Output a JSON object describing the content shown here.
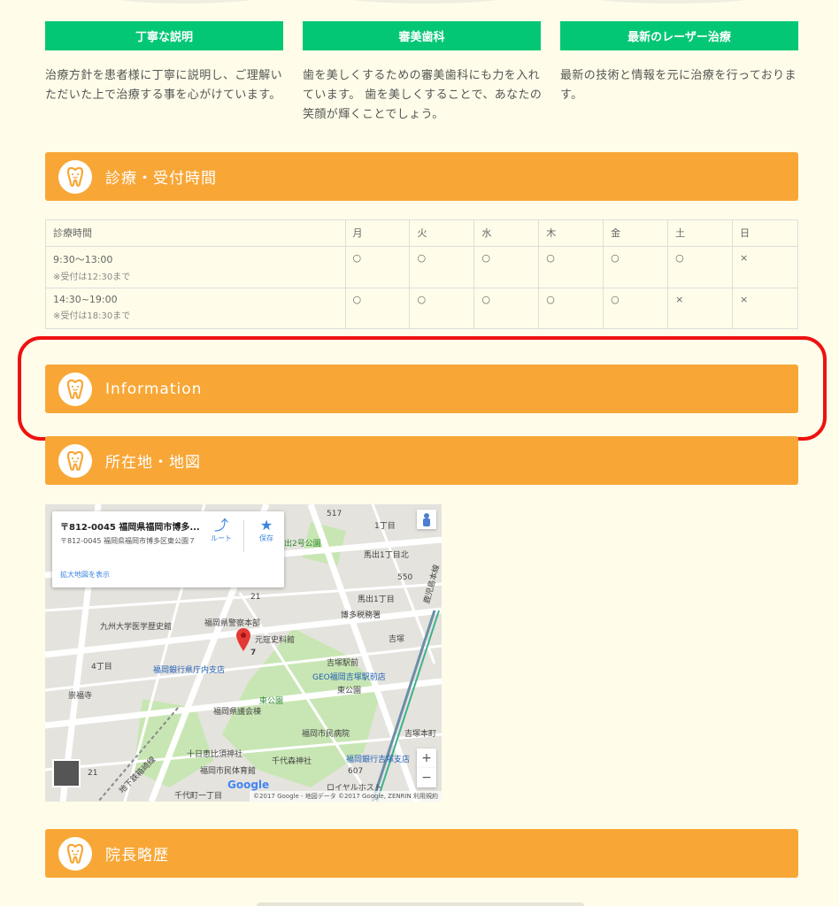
{
  "features": [
    {
      "label": "丁寧な説明",
      "text": "治療方針を患者様に丁寧に説明し、ご理解いただいた上で治療する事を心がけています。"
    },
    {
      "label": "審美歯科",
      "text": "歯を美しくするための審美歯科にも力を入れています。 歯を美しくすることで、あなたの笑顔が輝くことでしょう。"
    },
    {
      "label": "最新のレーザー治療",
      "text": "最新の技術と情報を元に治療を行っております。"
    }
  ],
  "sections": {
    "hours_title": "診療・受付時間",
    "info_title": "Information",
    "location_title": "所在地・地図",
    "profile_title": "院長略歴"
  },
  "hours_table": {
    "header": [
      "診療時間",
      "月",
      "火",
      "水",
      "木",
      "金",
      "土",
      "日"
    ],
    "rows": [
      {
        "time": "9:30～13:00",
        "note": "※受付は12:30まで",
        "marks": [
          "○",
          "○",
          "○",
          "○",
          "○",
          "○",
          "×"
        ]
      },
      {
        "time": "14:30~19:00",
        "note": "※受付は18:30まで",
        "marks": [
          "○",
          "○",
          "○",
          "○",
          "○",
          "×",
          "×"
        ]
      }
    ]
  },
  "map": {
    "card_title": "〒812-0045 福岡県福岡市博多...",
    "card_address": "〒812-0045 福岡県福岡市博多区東公園７",
    "directions_label": "ルート",
    "save_label": "保存",
    "larger_map_link": "拡大地図を表示",
    "labels": {
      "park2": "出2号公園",
      "kyushu_museum": "九州大学医学歴史館",
      "police": "福岡県警察本部",
      "genko": "元寇史料館",
      "tax": "博多税務署",
      "bank_branch": "福岡銀行県庁内支店",
      "geo": "GEO福岡吉塚駅前店",
      "higashi_park": "東公園",
      "assembly": "福岡県議会棟",
      "hospital": "福岡市民病院",
      "yoshizuka_honmachi": "吉塚本町",
      "tokaebisu": "十日恵比須神社",
      "chiyomori": "千代森神社",
      "yoshizuka_bank": "福岡銀行吉塚支店",
      "gym": "福岡市民体育館",
      "yoshizuka": "吉塚",
      "sofukuji": "崇福寺",
      "royal": "ロイヤルホスト",
      "marker_num": "7",
      "chome1": "1丁目",
      "chome4": "4丁目",
      "road517": "517",
      "road21": "21",
      "road550": "550",
      "road607": "607",
      "mazeshi1": "馬出1丁目北",
      "mazeshi2": "馬出1丁目",
      "yoshizuka_st": "吉塚駅前",
      "chiyo": "千代町一丁目",
      "east_line": "鹿児島本線",
      "subway": "地下鉄箱崎線",
      "higashi_koen2": "東公園"
    },
    "google_logo": "Google",
    "attribution": "©2017 Google - 地図データ ©2017 Google, ZENRIN   利用規約",
    "zoom_in": "+",
    "zoom_out": "−"
  },
  "colors": {
    "accent_green": "#04c775",
    "accent_orange": "#f8a737",
    "highlight_red": "#ee1111",
    "background": "#fffde9"
  }
}
